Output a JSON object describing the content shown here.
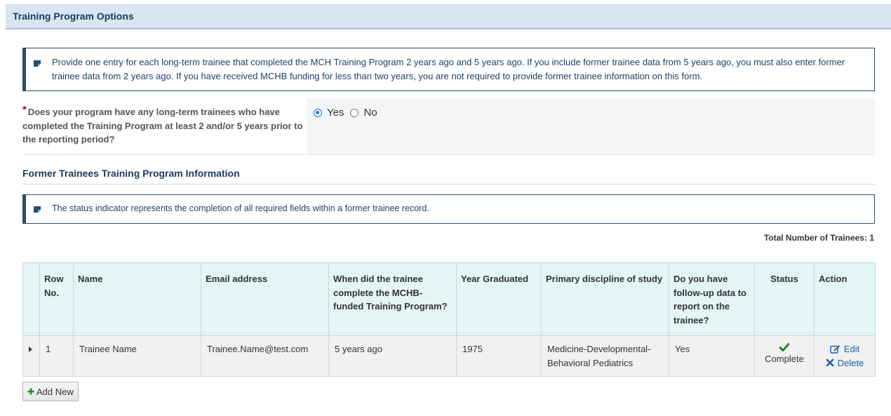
{
  "header": {
    "title": "Training Program Options"
  },
  "info_box_1": {
    "icon": "note-icon",
    "text": "Provide one entry for each long-term trainee that completed the MCH Training Program 2 years ago and 5 years ago. If you include former trainee data from 5 years ago, you must also enter former trainee data from 2 years ago. If you have received MCHB funding for less than two years, you are not required to provide former trainee information on this form."
  },
  "question": {
    "required_marker": "*",
    "label": "Does your program have any long-term trainees who have completed the Training Program at least 2 and/or 5 years prior to the reporting period?",
    "options": [
      {
        "label": "Yes",
        "checked": true
      },
      {
        "label": "No",
        "checked": false
      }
    ]
  },
  "section": {
    "title": "Former Trainees Training Program Information"
  },
  "info_box_2": {
    "icon": "note-icon",
    "text": "The status indicator represents the completion of all required fields within a former trainee record."
  },
  "total": {
    "label": "Total Number of Trainees:",
    "value": "1"
  },
  "table": {
    "headers": [
      "",
      "Row No.",
      "Name",
      "Email address",
      "When did the trainee complete the MCHB-funded Training Program?",
      "Year Graduated",
      "Primary discipline of study",
      "Do you have follow-up data to report on the trainee?",
      "Status",
      "Action"
    ],
    "rows": [
      {
        "row_no": "1",
        "name": "Trainee Name",
        "email": "Trainee.Name@test.com",
        "when": "5 years ago",
        "year": "1975",
        "discipline": "Medicine-Developmental-Behavioral Pediatrics",
        "followup": "Yes",
        "status": "Complete",
        "status_icon": "check-icon",
        "edit_label": "Edit",
        "delete_label": "Delete"
      }
    ]
  },
  "add_button": {
    "label": "Add New",
    "icon": "plus-icon"
  },
  "colors": {
    "accent": "#2a4d6e",
    "header_bg": "#d9e6f2",
    "table_header_bg": "#e3f5f5",
    "success": "#1e8a2e",
    "link": "#1a5fa8",
    "required": "#b00020"
  }
}
